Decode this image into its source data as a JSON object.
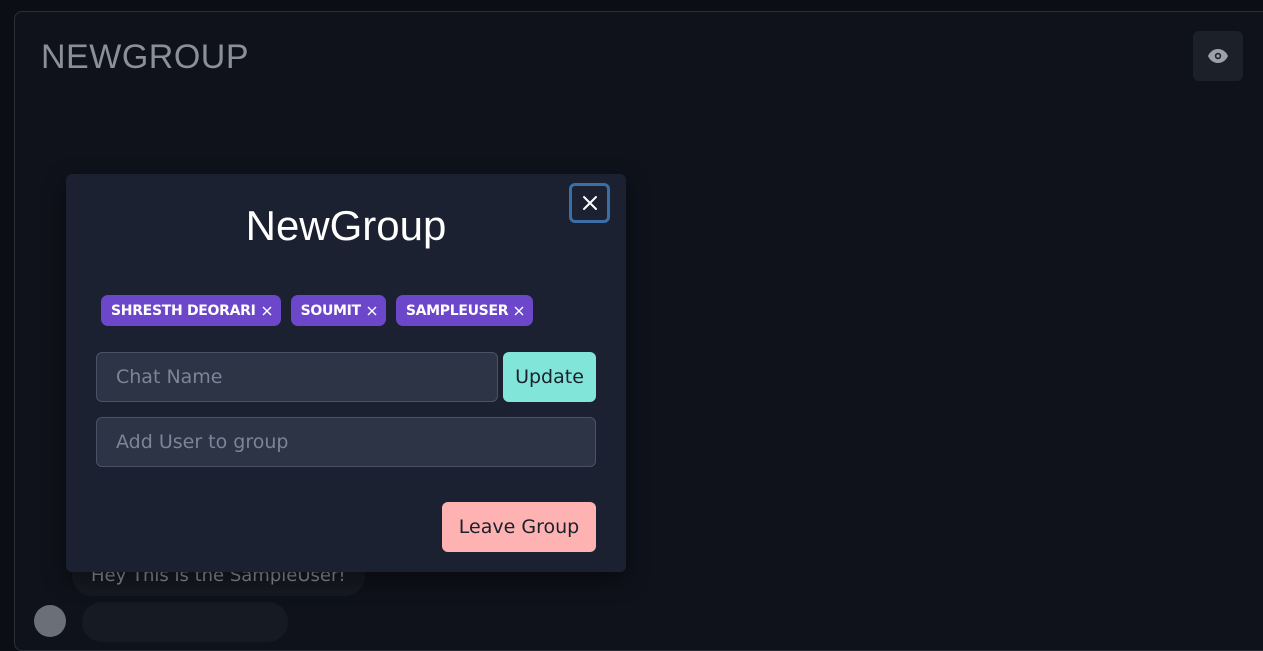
{
  "chat": {
    "title": "NEWGROUP",
    "eye_button_icon": "eye-icon",
    "messages": [
      {
        "text": "Hey This is the SampleUser!"
      },
      {
        "text": ""
      }
    ]
  },
  "modal": {
    "title": "NewGroup",
    "close_icon": "close-icon",
    "members": [
      {
        "name": "SHRESTH DEORARI"
      },
      {
        "name": "SOUMIT"
      },
      {
        "name": "SAMPLEUSER"
      }
    ],
    "chat_name_placeholder": "Chat Name",
    "chat_name_value": "",
    "update_label": "Update",
    "add_user_placeholder": "Add User to group",
    "add_user_value": "",
    "leave_label": "Leave Group"
  },
  "colors": {
    "badge": "#6c47c9",
    "update": "#81e6d9",
    "leave": "#feb2b2",
    "modal_bg": "#1b2130"
  }
}
